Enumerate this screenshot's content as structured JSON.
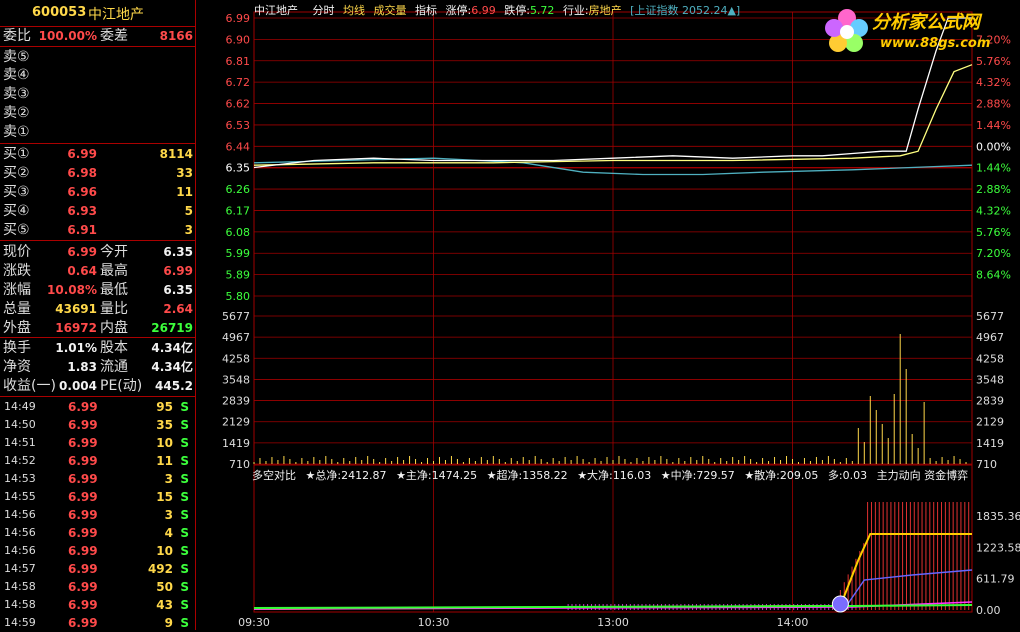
{
  "stock": {
    "code": "600053",
    "name": "中江地产"
  },
  "weibi": {
    "label": "委比",
    "value": "100.00%",
    "diff_label": "委差",
    "diff_value": "8166"
  },
  "sell": [
    {
      "label": "卖⑤",
      "price": "",
      "vol": ""
    },
    {
      "label": "卖④",
      "price": "",
      "vol": ""
    },
    {
      "label": "卖③",
      "price": "",
      "vol": ""
    },
    {
      "label": "卖②",
      "price": "",
      "vol": ""
    },
    {
      "label": "卖①",
      "price": "",
      "vol": ""
    }
  ],
  "buy": [
    {
      "label": "买①",
      "price": "6.99",
      "vol": "8114"
    },
    {
      "label": "买②",
      "price": "6.98",
      "vol": "33"
    },
    {
      "label": "买③",
      "price": "6.96",
      "vol": "11"
    },
    {
      "label": "买④",
      "price": "6.93",
      "vol": "5"
    },
    {
      "label": "买⑤",
      "price": "6.91",
      "vol": "3"
    }
  ],
  "quote": [
    {
      "l1": "现价",
      "v1": "6.99",
      "c1": "red",
      "l2": "今开",
      "v2": "6.35",
      "c2": "wht"
    },
    {
      "l1": "涨跌",
      "v1": "0.64",
      "c1": "red",
      "l2": "最高",
      "v2": "6.99",
      "c2": "red"
    },
    {
      "l1": "涨幅",
      "v1": "10.08%",
      "c1": "red",
      "l2": "最低",
      "v2": "6.35",
      "c2": "wht"
    },
    {
      "l1": "总量",
      "v1": "43691",
      "c1": "yel",
      "l2": "量比",
      "v2": "2.64",
      "c2": "red"
    },
    {
      "l1": "外盘",
      "v1": "16972",
      "c1": "red",
      "l2": "内盘",
      "v2": "26719",
      "c2": "grn"
    }
  ],
  "fund": [
    {
      "l1": "换手",
      "v1": "1.01%",
      "l2": "股本",
      "v2": "4.34亿"
    },
    {
      "l1": "净资",
      "v1": "1.83",
      "l2": "流通",
      "v2": "4.34亿"
    },
    {
      "l1": "收益(一)",
      "v1": "0.004",
      "l2": "PE(动)",
      "v2": "445.2"
    }
  ],
  "ticks": [
    {
      "t": "14:49",
      "p": "6.99",
      "v": "95",
      "s": "S"
    },
    {
      "t": "14:50",
      "p": "6.99",
      "v": "35",
      "s": "S"
    },
    {
      "t": "14:51",
      "p": "6.99",
      "v": "10",
      "s": "S"
    },
    {
      "t": "14:52",
      "p": "6.99",
      "v": "11",
      "s": "S"
    },
    {
      "t": "14:53",
      "p": "6.99",
      "v": "3",
      "s": "S"
    },
    {
      "t": "14:55",
      "p": "6.99",
      "v": "15",
      "s": "S"
    },
    {
      "t": "14:56",
      "p": "6.99",
      "v": "3",
      "s": "S"
    },
    {
      "t": "14:56",
      "p": "6.99",
      "v": "4",
      "s": "S"
    },
    {
      "t": "14:56",
      "p": "6.99",
      "v": "10",
      "s": "S"
    },
    {
      "t": "14:57",
      "p": "6.99",
      "v": "492",
      "s": "S"
    },
    {
      "t": "14:58",
      "p": "6.99",
      "v": "50",
      "s": "S"
    },
    {
      "t": "14:58",
      "p": "6.99",
      "v": "43",
      "s": "S"
    },
    {
      "t": "14:59",
      "p": "6.99",
      "v": "9",
      "s": "S"
    }
  ],
  "chart_header": {
    "name": "中江地产",
    "tab1": "分时",
    "tab2": "均线",
    "tab3": "成交量",
    "tab4": "指标",
    "zt_label": "涨停:",
    "zt_value": "6.99",
    "dt_label": "跌停:",
    "dt_value": "5.72",
    "industry_label": "行业:",
    "industry_value": "房地产",
    "index_label": "[上证指数",
    "index_value": "2052.24▲]"
  },
  "ddx_header": {
    "title": "多空对比",
    "items": [
      "★总净:2412.87",
      "★主净:1474.25",
      "★超净:1358.22",
      "★大净:116.03",
      "★中净:729.57",
      "★散净:209.05",
      "多:0.03",
      "主力动向 资金博弈"
    ]
  },
  "logo": {
    "t1": "分析家公式网",
    "t2": "www.88gs.com"
  },
  "colors": {
    "up": "#ff4a4a",
    "down": "#3cff3c",
    "grid": "#a00000",
    "price": "#ffffff",
    "avg": "#ffff80",
    "index": "#4fb0c0",
    "volume": "#ffd84a"
  },
  "chart_data": {
    "type": "line",
    "time_ticks": [
      "09:30",
      "10:30",
      "13:00",
      "14:00"
    ],
    "price_axis_left": [
      "6.99",
      "6.90",
      "6.81",
      "6.72",
      "6.62",
      "6.53",
      "6.44",
      "6.35",
      "6.26",
      "6.17",
      "6.08",
      "5.99",
      "5.89",
      "5.80"
    ],
    "percent_axis_right": [
      "7.20%",
      "5.76%",
      "4.32%",
      "2.88%",
      "1.44%",
      "0.00%",
      "1.44%",
      "2.88%",
      "4.32%",
      "5.76%",
      "7.20%",
      "8.64%"
    ],
    "volume_axis": [
      "5677",
      "4967",
      "4258",
      "3548",
      "2839",
      "2129",
      "1419",
      "710"
    ],
    "ddx_axis": [
      "1835.36",
      "1223.58",
      "611.79",
      "0.00"
    ],
    "base_price": 6.35,
    "price_series": [
      [
        0,
        6.35
      ],
      [
        20,
        6.38
      ],
      [
        40,
        6.39
      ],
      [
        60,
        6.38
      ],
      [
        80,
        6.38
      ],
      [
        100,
        6.38
      ],
      [
        120,
        6.39
      ],
      [
        140,
        6.4
      ],
      [
        160,
        6.39
      ],
      [
        180,
        6.4
      ],
      [
        190,
        6.4
      ],
      [
        200,
        6.41
      ],
      [
        210,
        6.42
      ],
      [
        218,
        6.42
      ],
      [
        222,
        6.6
      ],
      [
        228,
        6.85
      ],
      [
        232,
        6.99
      ],
      [
        240,
        6.99
      ]
    ],
    "avg_series": [
      [
        0,
        6.36
      ],
      [
        40,
        6.37
      ],
      [
        80,
        6.37
      ],
      [
        120,
        6.38
      ],
      [
        160,
        6.38
      ],
      [
        200,
        6.39
      ],
      [
        216,
        6.4
      ],
      [
        222,
        6.42
      ],
      [
        228,
        6.6
      ],
      [
        234,
        6.76
      ],
      [
        240,
        6.79
      ]
    ],
    "index_series": [
      [
        0,
        6.37
      ],
      [
        30,
        6.38
      ],
      [
        60,
        6.39
      ],
      [
        90,
        6.37
      ],
      [
        110,
        6.33
      ],
      [
        130,
        6.32
      ],
      [
        150,
        6.32
      ],
      [
        170,
        6.33
      ],
      [
        200,
        6.34
      ],
      [
        240,
        6.36
      ]
    ]
  }
}
